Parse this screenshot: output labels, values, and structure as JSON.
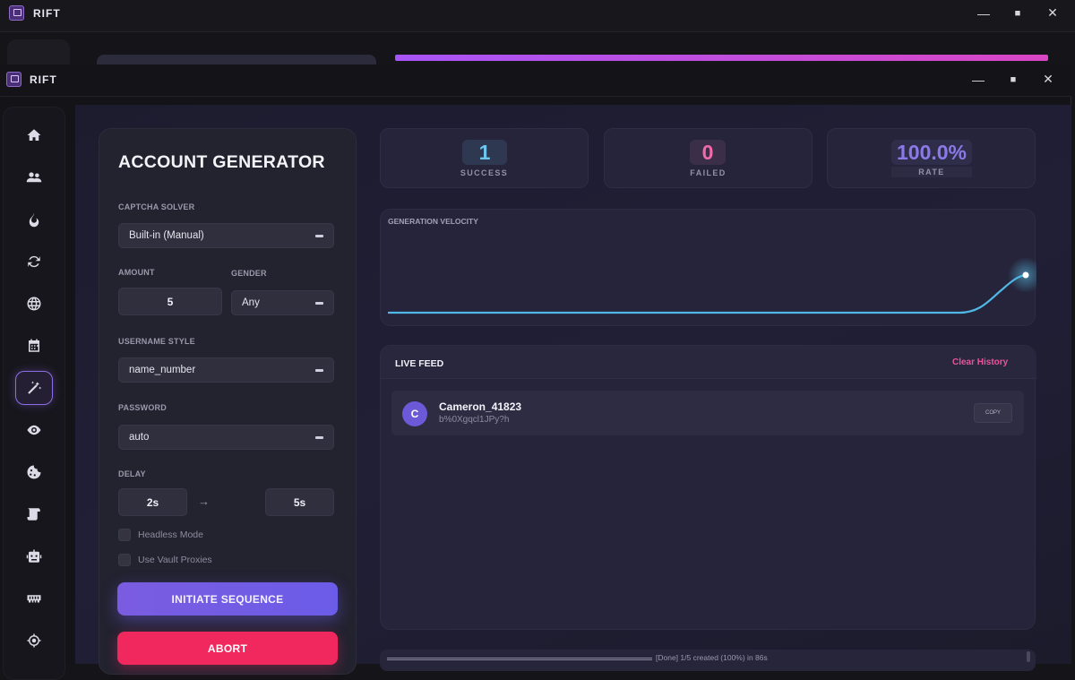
{
  "app": {
    "name": "RIFT"
  },
  "window_controls": {
    "minimize": "—",
    "maximize": "■",
    "close": "✕"
  },
  "sidebar": {
    "items": [
      {
        "name": "home-icon"
      },
      {
        "name": "users-icon"
      },
      {
        "name": "fire-icon"
      },
      {
        "name": "sync-icon"
      },
      {
        "name": "globe-icon"
      },
      {
        "name": "calendar-icon"
      },
      {
        "name": "magic-wand-icon",
        "active": true
      },
      {
        "name": "eye-icon"
      },
      {
        "name": "cookie-icon"
      },
      {
        "name": "scroll-icon"
      },
      {
        "name": "robot-icon"
      },
      {
        "name": "memory-icon"
      },
      {
        "name": "crosshair-icon"
      }
    ]
  },
  "generator": {
    "title": "ACCOUNT GENERATOR",
    "captcha_label": "CAPTCHA SOLVER",
    "captcha_value": "Built-in (Manual)",
    "amount_label": "AMOUNT",
    "amount_value": "5",
    "gender_label": "GENDER",
    "gender_value": "Any",
    "username_label": "USERNAME STYLE",
    "username_value": "name_number",
    "password_label": "PASSWORD",
    "password_value": "auto",
    "delay_label": "DELAY",
    "delay_min": "2s",
    "delay_arrow": "→",
    "delay_max": "5s",
    "headless_label": "Headless Mode",
    "vault_label": "Use Vault Proxies",
    "initiate_label": "INITIATE SEQUENCE",
    "abort_label": "ABORT"
  },
  "stats": {
    "success_value": "1",
    "success_label": "SUCCESS",
    "failed_value": "0",
    "failed_label": "FAILED",
    "rate_value": "100.0%",
    "rate_label": "RATE"
  },
  "colors": {
    "success": "#6ec6f0",
    "failed": "#f06ba8",
    "rate": "#8a7ae8",
    "accent": "#7a5ce0",
    "danger": "#f0285e"
  },
  "velocity": {
    "title": "GENERATION VELOCITY",
    "line_color": "#4fb8e6"
  },
  "live_feed": {
    "title": "LIVE FEED",
    "clear_label": "Clear History",
    "entries": [
      {
        "initial": "C",
        "username": "Cameron_41823",
        "password": "b%0Xgqcl1JPy?h",
        "copy_label": "COPY"
      }
    ]
  },
  "status": {
    "text": "[Done] 1/5 created (100%) in 86s"
  }
}
